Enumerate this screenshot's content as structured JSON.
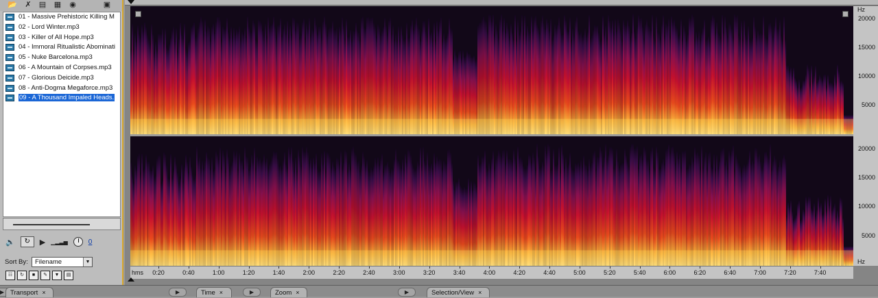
{
  "toolbar": {
    "icons": [
      "open-file-icon",
      "close-file-icon",
      "import-icon",
      "insert-icon",
      "autoplay-icon",
      "options-icon"
    ]
  },
  "files": [
    {
      "label": "01 - Massive Prehistoric Killing M",
      "selected": false
    },
    {
      "label": "02 - Lord Winter.mp3",
      "selected": false
    },
    {
      "label": "03 - Killer of All Hope.mp3",
      "selected": false
    },
    {
      "label": "04 - Immoral Ritualistic Abominati",
      "selected": false
    },
    {
      "label": "05 - Nuke Barcelona.mp3",
      "selected": false
    },
    {
      "label": "06 - A Mountain of Corpses.mp3",
      "selected": false
    },
    {
      "label": "07 - Glorious Deicide.mp3",
      "selected": false
    },
    {
      "label": "08 - Anti-Dogma Megaforce.mp3",
      "selected": false
    },
    {
      "label": "09 - A Thousand Impaled Heads.",
      "selected": true
    }
  ],
  "preview": {
    "volume_value": "0"
  },
  "sort": {
    "label": "Sort By:",
    "value": "Filename"
  },
  "freq_ruler": {
    "unit": "Hz",
    "ch1_labels": [
      "20000",
      "15000",
      "10000",
      "5000"
    ],
    "ch2_labels": [
      "20000",
      "15000",
      "10000",
      "5000"
    ],
    "ch2_unit": "Hz"
  },
  "time_ruler": {
    "unit": "hms",
    "labels": [
      "0:20",
      "0:40",
      "1:00",
      "1:20",
      "1:40",
      "2:00",
      "2:20",
      "2:40",
      "3:00",
      "3:20",
      "3:40",
      "4:00",
      "4:20",
      "4:40",
      "5:00",
      "5:20",
      "5:40",
      "6:00",
      "6:20",
      "6:40",
      "7:00",
      "7:20",
      "7:40"
    ]
  },
  "tabs": {
    "transport": "Transport",
    "time": "Time",
    "zoom": "Zoom",
    "selection_view": "Selection/View",
    "close_glyph": "×"
  },
  "colors": {
    "spectrum_low": "#1a0a2e",
    "spectrum_mid": "#c8102e",
    "spectrum_high": "#ffd35a",
    "selection": "#1a66d6",
    "panel_border": "#d8a72b"
  }
}
